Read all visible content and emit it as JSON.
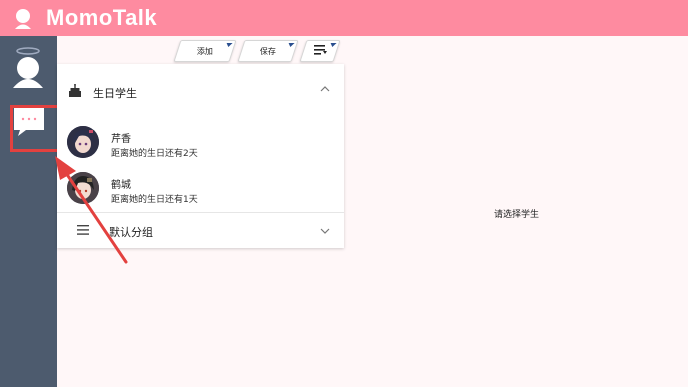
{
  "app": {
    "title": "MomoTalk"
  },
  "toolbar": {
    "add_label": "添加",
    "save_label": "保存",
    "menu_icon": "list-menu-icon"
  },
  "groups": [
    {
      "title": "生日学生",
      "icon": "cake-icon",
      "expanded": true,
      "students": [
        {
          "name": "芹香",
          "subtitle": "距离她的生日还有2天"
        },
        {
          "name": "鹤城",
          "subtitle": "距离她的生日还有1天"
        }
      ]
    },
    {
      "title": "默认分组",
      "icon": "list-icon",
      "expanded": false
    }
  ],
  "content": {
    "empty_hint": "请选择学生"
  },
  "colors": {
    "header": "#fe8ba0",
    "sidebar": "#4d5b6e",
    "annotation": "#e3413f",
    "background": "#fff7f8"
  }
}
